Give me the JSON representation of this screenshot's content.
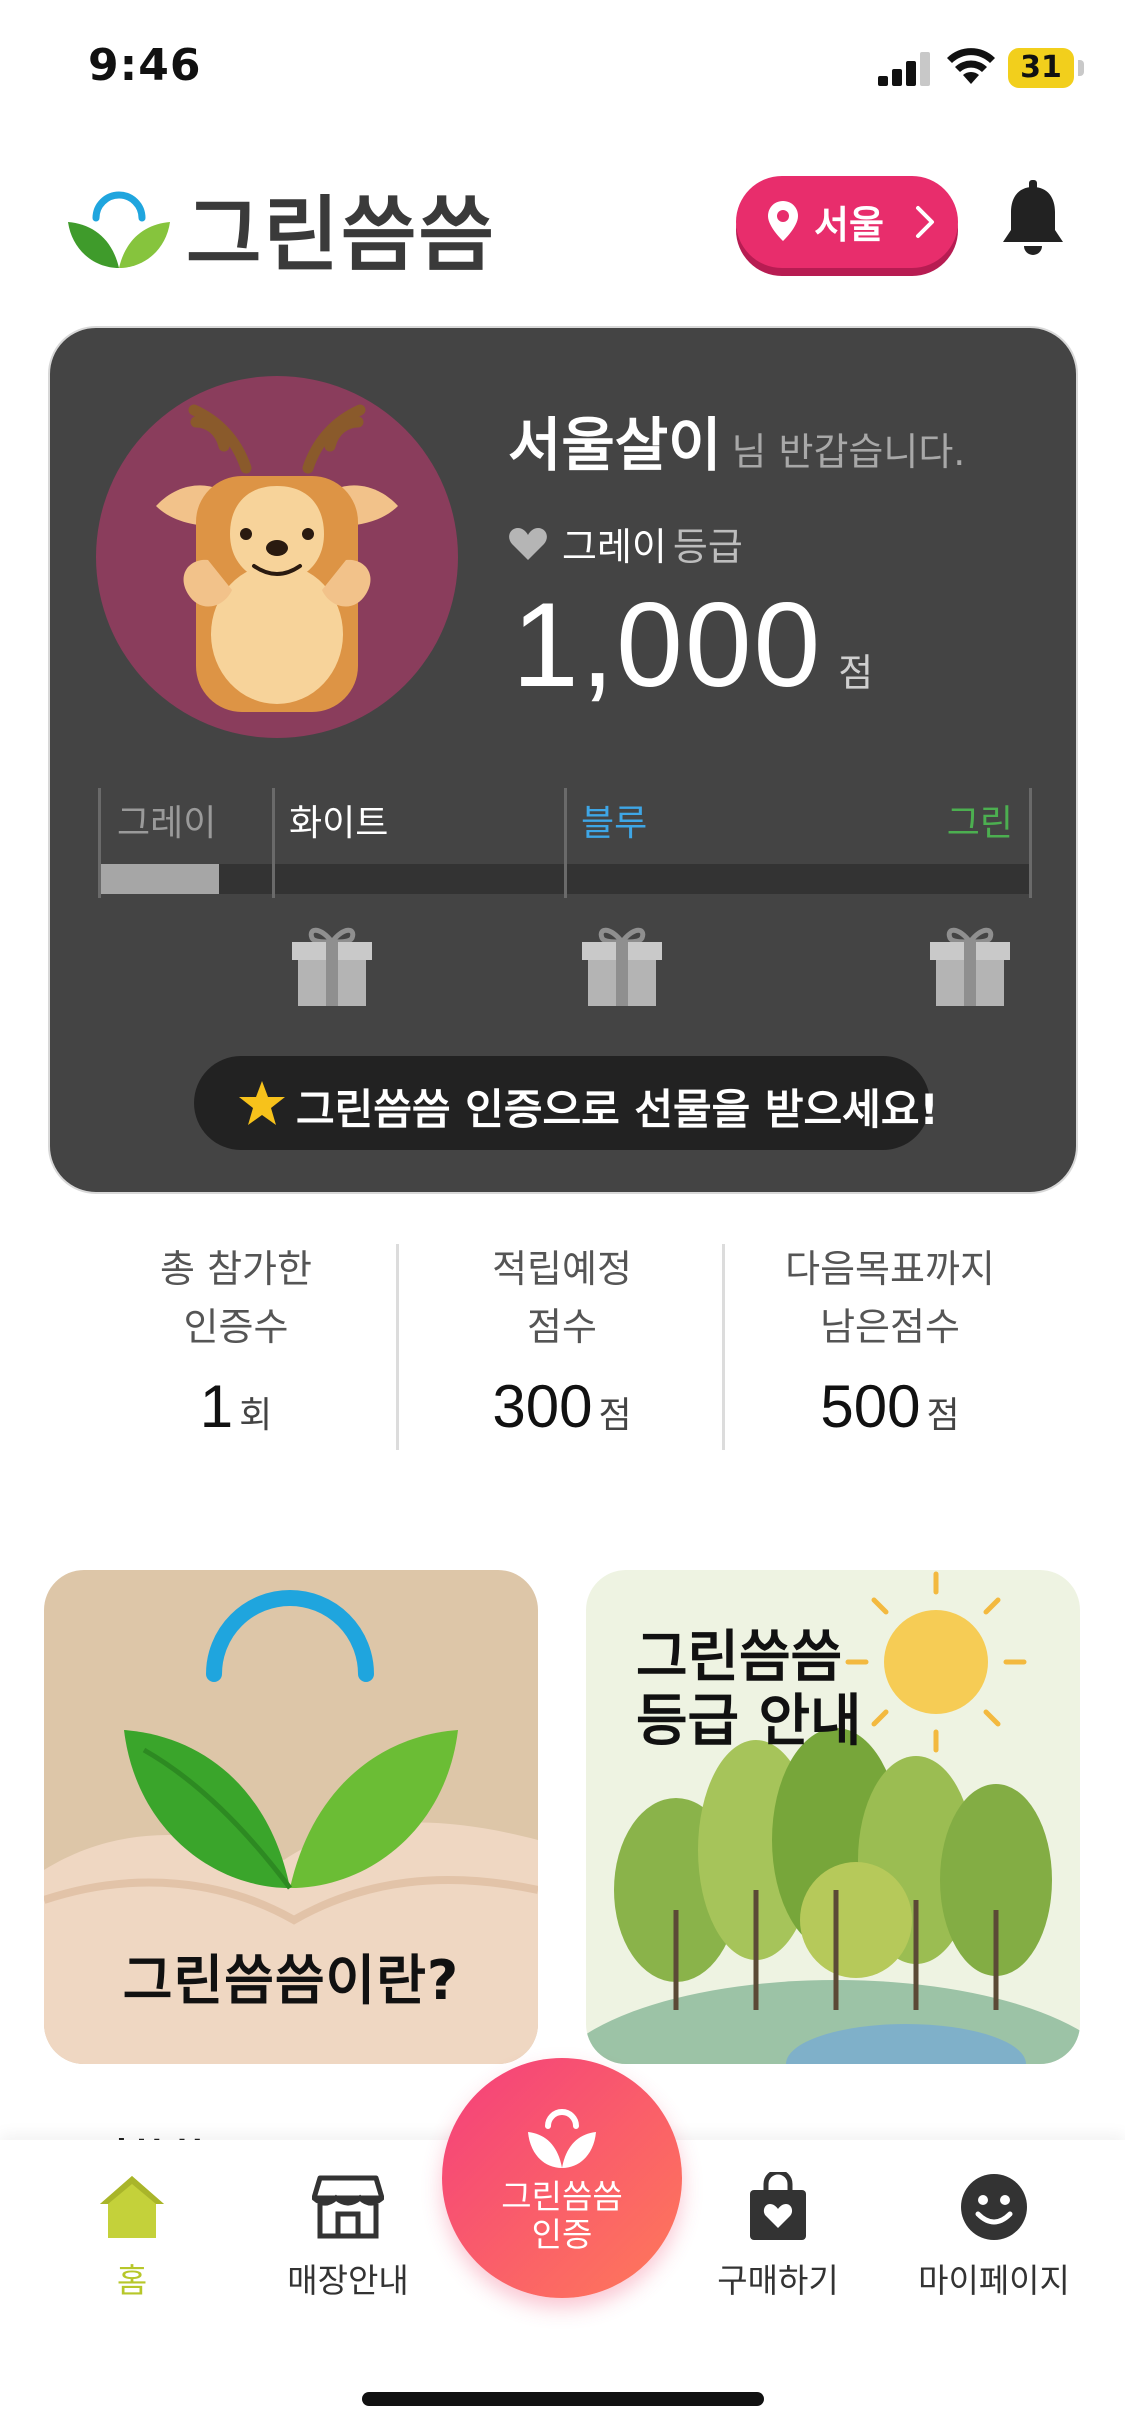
{
  "status_bar": {
    "time": "9:46",
    "battery": "31"
  },
  "header": {
    "app_name": "그린씀씀",
    "location": "서울"
  },
  "profile": {
    "user_name": "서울살이",
    "greeting_suffix": "님 반갑습니다.",
    "grade_name": "그레이",
    "grade_suffix": "등급",
    "points": "1,000",
    "points_unit": "점",
    "progress_fraction": 0.13,
    "tiers": [
      {
        "label": "그레이",
        "color": "#9a9a9a"
      },
      {
        "label": "화이트",
        "color": "#ffffff"
      },
      {
        "label": "블루",
        "color": "#3ea6e6"
      },
      {
        "label": "그린",
        "color": "#4caf50"
      }
    ],
    "cert_banner": "그린씀씀 인증으로 선물을 받으세요!"
  },
  "stats": [
    {
      "label_line1": "총 참가한",
      "label_line2": "인증수",
      "value": "1",
      "unit": "회"
    },
    {
      "label_line1": "적립예정",
      "label_line2": "점수",
      "value": "300",
      "unit": "점"
    },
    {
      "label_line1": "다음목표까지",
      "label_line2": "남은점수",
      "value": "500",
      "unit": "점"
    }
  ],
  "promos": {
    "left_title": "그린씀씀이란?",
    "right_title_line1": "그린씀씀",
    "right_title_line2": "등급 안내"
  },
  "section_peek": "그린씀씀",
  "nav": {
    "home": "홈",
    "stores": "매장안내",
    "cert_line1": "그린씀씀",
    "cert_line2": "인증",
    "buy": "구매하기",
    "mypage": "마이페이지"
  },
  "colors": {
    "accent_pink": "#e82d6c",
    "active_nav": "#b7c72a",
    "card_bg": "#444444"
  }
}
